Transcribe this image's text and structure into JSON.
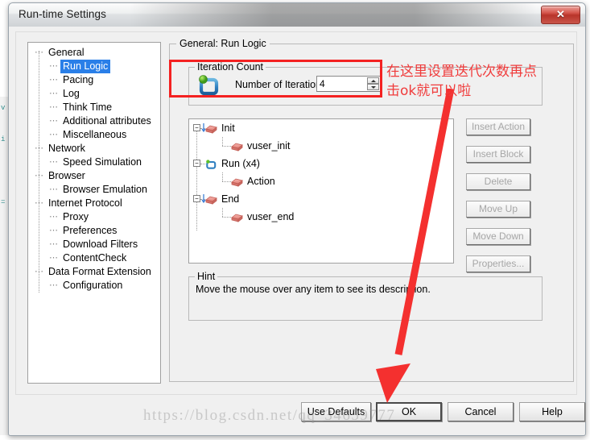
{
  "window": {
    "title": "Run-time Settings",
    "close_label": "✕"
  },
  "sidebar": {
    "items": [
      {
        "label": "General",
        "level": 0,
        "selected": false
      },
      {
        "label": "Run Logic",
        "level": 1,
        "selected": true
      },
      {
        "label": "Pacing",
        "level": 1,
        "selected": false
      },
      {
        "label": "Log",
        "level": 1,
        "selected": false
      },
      {
        "label": "Think Time",
        "level": 1,
        "selected": false
      },
      {
        "label": "Additional attributes",
        "level": 1,
        "selected": false
      },
      {
        "label": "Miscellaneous",
        "level": 1,
        "selected": false
      },
      {
        "label": "Network",
        "level": 0,
        "selected": false
      },
      {
        "label": "Speed Simulation",
        "level": 1,
        "selected": false
      },
      {
        "label": "Browser",
        "level": 0,
        "selected": false
      },
      {
        "label": "Browser Emulation",
        "level": 1,
        "selected": false
      },
      {
        "label": "Internet Protocol",
        "level": 0,
        "selected": false
      },
      {
        "label": "Proxy",
        "level": 1,
        "selected": false
      },
      {
        "label": "Preferences",
        "level": 1,
        "selected": false
      },
      {
        "label": "Download Filters",
        "level": 1,
        "selected": false
      },
      {
        "label": "ContentCheck",
        "level": 1,
        "selected": false
      },
      {
        "label": "Data Format Extension",
        "level": 0,
        "selected": false
      },
      {
        "label": "Configuration",
        "level": 1,
        "selected": false
      }
    ]
  },
  "main": {
    "group_title": "General: Run Logic",
    "iteration": {
      "group_title": "Iteration Count",
      "icon": "loop-icon",
      "label": "Number of Iterations:",
      "value": "4",
      "spinner_up": "spinner-up-icon",
      "spinner_down": "spinner-down-icon"
    },
    "action_tree": [
      {
        "label": "Init",
        "level": 0,
        "expander": "−",
        "icon": "init-block-icon"
      },
      {
        "label": "vuser_init",
        "level": 1,
        "expander": "",
        "icon": "block-icon"
      },
      {
        "label": "Run (x4)",
        "level": 0,
        "expander": "−",
        "icon": "loop-icon"
      },
      {
        "label": "Action",
        "level": 1,
        "expander": "",
        "icon": "block-icon"
      },
      {
        "label": "End",
        "level": 0,
        "expander": "−",
        "icon": "end-block-icon"
      },
      {
        "label": "vuser_end",
        "level": 1,
        "expander": "",
        "icon": "block-icon"
      }
    ],
    "side_buttons": [
      {
        "label": "Insert Action",
        "enabled": false
      },
      {
        "label": "Insert Block",
        "enabled": false
      },
      {
        "label": "Delete",
        "enabled": false
      },
      {
        "label": "Move Up",
        "enabled": false
      },
      {
        "label": "Move Down",
        "enabled": false
      },
      {
        "label": "Properties...",
        "enabled": false
      }
    ],
    "hint": {
      "group_title": "Hint",
      "text": "Move the mouse over any item to see its description."
    }
  },
  "footer": {
    "buttons": [
      {
        "id": "use-defaults",
        "label": "Use Defaults"
      },
      {
        "id": "ok",
        "label": "OK"
      },
      {
        "id": "cancel",
        "label": "Cancel"
      },
      {
        "id": "help",
        "label": "Help"
      }
    ]
  },
  "annotations": {
    "highlight_color": "#f42121",
    "note_line1": "在这里设置迭代次数再点",
    "note_line2": "击ok就可以啦",
    "arrow_target": "ok-button"
  },
  "watermark": {
    "text": "https://blog.csdn.net/qq_34659777"
  },
  "background": {
    "code_snippet": "v\n\n\ni\n\n\n\n\n\n="
  }
}
